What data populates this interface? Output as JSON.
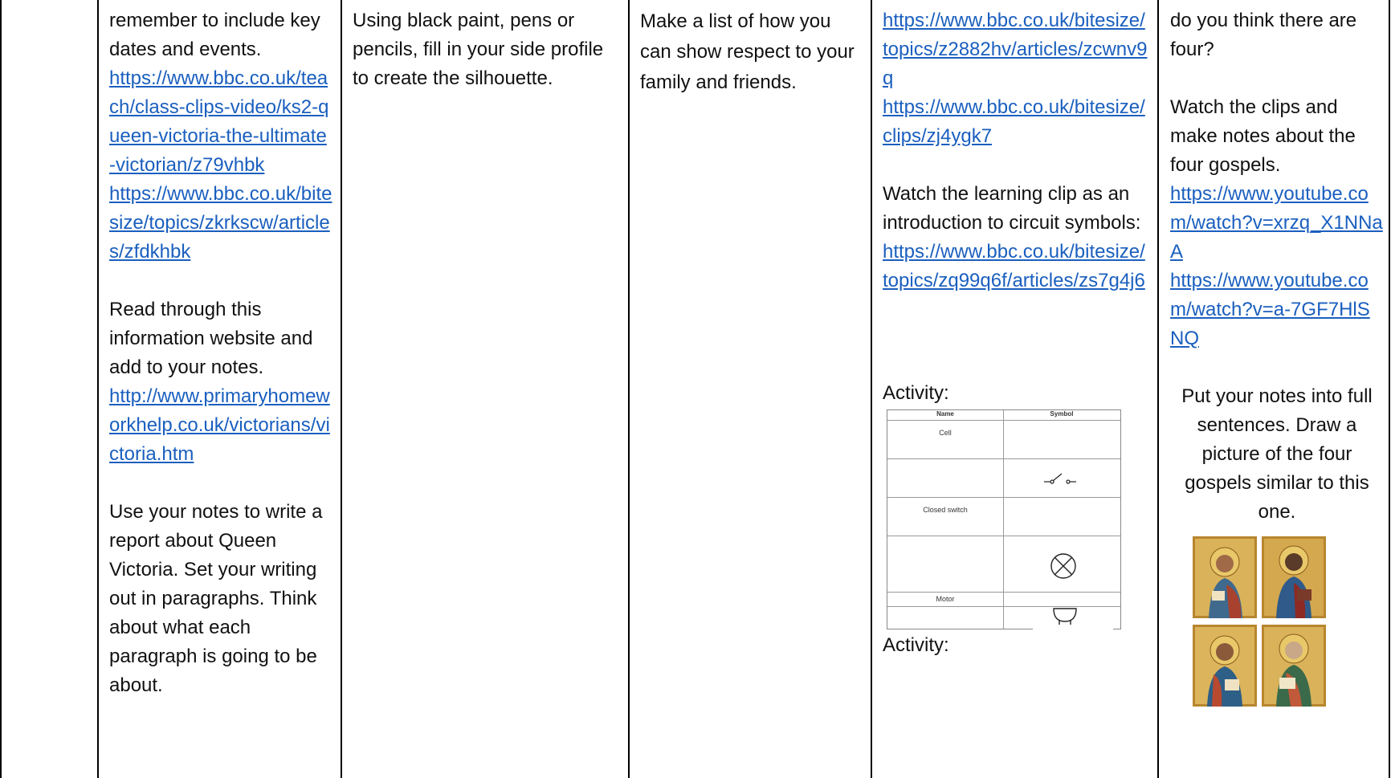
{
  "col1": {
    "text1": "remember to include key dates and events.",
    "link1": "https://www.bbc.co.uk/teach/class-clips-video/ks2-queen-victoria-the-ultimate-victorian/z79vhbk",
    "link2": "https://www.bbc.co.uk/bitesize/topics/zkrkscw/articles/zfdkhbk",
    "text2": "Read through this information website and add to your notes.",
    "link3": "http://www.primaryhomeworkhelp.co.uk/victorians/victoria.htm",
    "text3": "Use your notes to write a report about Queen Victoria. Set your writing out in paragraphs. Think about what each paragraph is going to be about."
  },
  "col2": {
    "text1": "Using black paint, pens or pencils, fill in your side profile to create the silhouette."
  },
  "col3": {
    "text1": "Make a list of how you can show respect to your family and friends."
  },
  "col4": {
    "link1": "https://www.bbc.co.uk/bitesize/topics/z2882hv/articles/zcwnv9q",
    "link2": "https://www.bbc.co.uk/bitesize/clips/zj4ygk7",
    "text1": "Watch the learning clip as an introduction to circuit symbols:",
    "link3": "https://www.bbc.co.uk/bitesize/topics/zq99q6f/articles/zs7g4j6",
    "activity1": "Activity:",
    "activity2": "Activity:",
    "circuit_table": {
      "header_name": "Name",
      "header_symbol": "Symbol",
      "rows": [
        "Cell",
        "",
        "Closed switch",
        "",
        "Motor",
        ""
      ]
    }
  },
  "col5": {
    "text1": "do you think there are four?",
    "text2": "Watch the clips and make notes about the four gospels.",
    "link1": "https://www.youtube.com/watch?v=xrzq_X1NNaA",
    "link2": "https://www.youtube.com/watch?v=a-7GF7HlSNQ",
    "text3": "Put your notes into full sentences. Draw a picture of the four gospels similar to this one."
  },
  "colors": {
    "link": "#1a5fbf",
    "border": "#000000"
  }
}
